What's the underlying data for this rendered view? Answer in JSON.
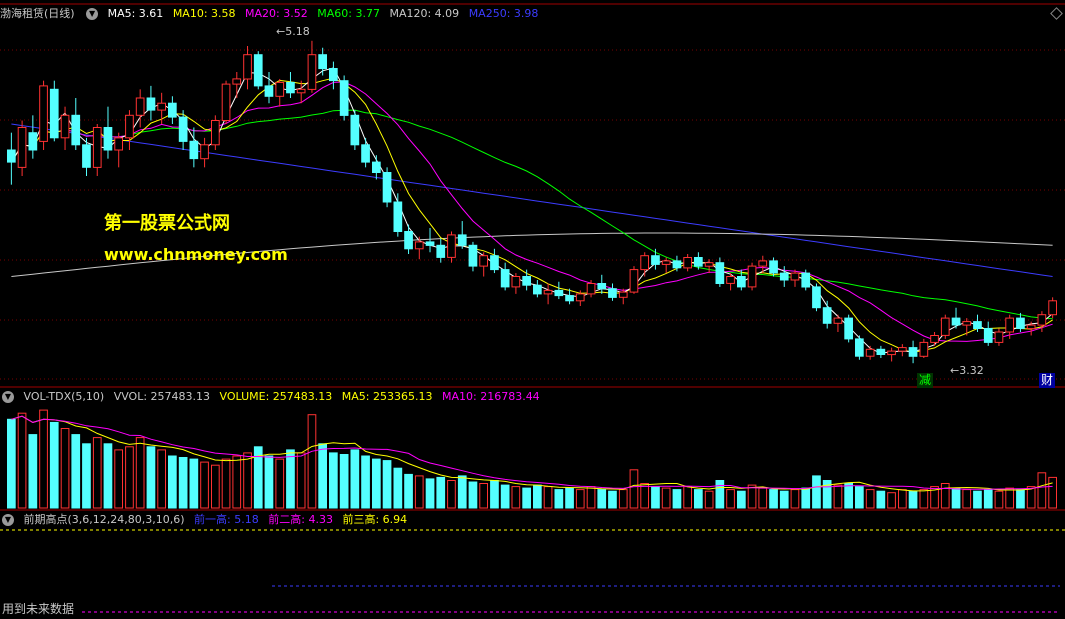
{
  "header": {
    "stock_name": "渤海租赁(日线)",
    "ma5": "MA5: 3.61",
    "ma10": "MA10: 3.58",
    "ma20": "MA20: 3.52",
    "ma60": "MA60: 3.77",
    "ma120": "MA120: 4.09",
    "ma250": "MA250: 3.98"
  },
  "vol_header": {
    "name": "VOL-TDX(5,10)",
    "vvol": "VVOL: 257483.13",
    "volume": "VOLUME: 257483.13",
    "ma5": "MA5: 253365.13",
    "ma10": "MA10: 216783.44"
  },
  "ind_header": {
    "name": "前期高点(3,6,12,24,80,3,10,6)",
    "h1": "前一高: 5.18",
    "h2": "前二高: 4.33",
    "h3": "前三高: 6.94"
  },
  "watermark": {
    "line1": "第一股票公式网",
    "line2": "www.chnmoney.com"
  },
  "annotations": {
    "high": "5.18",
    "low": "3.32",
    "tag_jian": "减",
    "tag_cai": "财"
  },
  "footer": "用到未来数据",
  "colors": {
    "up": "#ff3232",
    "down": "#54ffff",
    "ma5": "#ffffff",
    "ma10": "#ffff00",
    "ma20": "#ff00ff",
    "ma60": "#00ff00",
    "ma120": "#c8c8c8",
    "ma250": "#3c3cff",
    "grid": "#7a0000"
  },
  "chart_data": [
    {
      "type": "candlestick",
      "ylim": [
        3.2,
        5.3
      ],
      "annotated_high": 5.18,
      "annotated_low": 3.32,
      "candles": [
        [
          4.55,
          4.65,
          4.35,
          4.48
        ],
        [
          4.45,
          4.72,
          4.4,
          4.68
        ],
        [
          4.65,
          4.75,
          4.5,
          4.55
        ],
        [
          4.6,
          4.95,
          4.55,
          4.92
        ],
        [
          4.9,
          4.95,
          4.6,
          4.62
        ],
        [
          4.62,
          4.8,
          4.55,
          4.75
        ],
        [
          4.75,
          4.85,
          4.55,
          4.58
        ],
        [
          4.58,
          4.62,
          4.4,
          4.45
        ],
        [
          4.45,
          4.7,
          4.4,
          4.68
        ],
        [
          4.68,
          4.8,
          4.5,
          4.55
        ],
        [
          4.55,
          4.65,
          4.45,
          4.62
        ],
        [
          4.62,
          4.78,
          4.55,
          4.75
        ],
        [
          4.75,
          4.9,
          4.68,
          4.85
        ],
        [
          4.85,
          4.92,
          4.72,
          4.78
        ],
        [
          4.78,
          4.88,
          4.7,
          4.82
        ],
        [
          4.82,
          4.86,
          4.7,
          4.74
        ],
        [
          4.74,
          4.78,
          4.55,
          4.6
        ],
        [
          4.6,
          4.68,
          4.45,
          4.5
        ],
        [
          4.5,
          4.62,
          4.45,
          4.58
        ],
        [
          4.58,
          4.75,
          4.55,
          4.72
        ],
        [
          4.72,
          4.95,
          4.7,
          4.93
        ],
        [
          4.93,
          5.0,
          4.85,
          4.96
        ],
        [
          4.96,
          5.15,
          4.9,
          5.1
        ],
        [
          5.1,
          5.12,
          4.9,
          4.92
        ],
        [
          4.92,
          5.0,
          4.82,
          4.86
        ],
        [
          4.86,
          4.96,
          4.8,
          4.94
        ],
        [
          4.94,
          5.0,
          4.85,
          4.88
        ],
        [
          4.88,
          4.95,
          4.82,
          4.9
        ],
        [
          4.9,
          5.18,
          4.88,
          5.1
        ],
        [
          5.1,
          5.14,
          4.98,
          5.02
        ],
        [
          5.02,
          5.06,
          4.9,
          4.95
        ],
        [
          4.95,
          4.98,
          4.72,
          4.75
        ],
        [
          4.75,
          4.78,
          4.55,
          4.58
        ],
        [
          4.58,
          4.62,
          4.45,
          4.48
        ],
        [
          4.48,
          4.52,
          4.38,
          4.42
        ],
        [
          4.42,
          4.45,
          4.22,
          4.25
        ],
        [
          4.25,
          4.3,
          4.05,
          4.08
        ],
        [
          4.08,
          4.12,
          3.95,
          3.98
        ],
        [
          3.98,
          4.05,
          3.92,
          4.02
        ],
        [
          4.02,
          4.1,
          3.96,
          4.0
        ],
        [
          4.0,
          4.04,
          3.9,
          3.93
        ],
        [
          3.93,
          4.08,
          3.9,
          4.06
        ],
        [
          4.06,
          4.14,
          3.98,
          4.0
        ],
        [
          4.0,
          4.02,
          3.85,
          3.88
        ],
        [
          3.88,
          3.96,
          3.82,
          3.94
        ],
        [
          3.94,
          3.98,
          3.84,
          3.86
        ],
        [
          3.86,
          3.9,
          3.74,
          3.76
        ],
        [
          3.76,
          3.84,
          3.72,
          3.82
        ],
        [
          3.82,
          3.86,
          3.74,
          3.77
        ],
        [
          3.77,
          3.8,
          3.7,
          3.72
        ],
        [
          3.72,
          3.78,
          3.66,
          3.74
        ],
        [
          3.74,
          3.79,
          3.69,
          3.71
        ],
        [
          3.71,
          3.75,
          3.66,
          3.68
        ],
        [
          3.68,
          3.74,
          3.65,
          3.72
        ],
        [
          3.72,
          3.8,
          3.7,
          3.78
        ],
        [
          3.78,
          3.83,
          3.72,
          3.75
        ],
        [
          3.75,
          3.78,
          3.68,
          3.7
        ],
        [
          3.7,
          3.75,
          3.66,
          3.73
        ],
        [
          3.73,
          3.88,
          3.72,
          3.86
        ],
        [
          3.86,
          3.96,
          3.82,
          3.94
        ],
        [
          3.94,
          3.98,
          3.86,
          3.89
        ],
        [
          3.89,
          3.93,
          3.84,
          3.91
        ],
        [
          3.91,
          3.94,
          3.85,
          3.87
        ],
        [
          3.87,
          3.95,
          3.85,
          3.93
        ],
        [
          3.93,
          3.96,
          3.86,
          3.88
        ],
        [
          3.88,
          3.92,
          3.84,
          3.9
        ],
        [
          3.9,
          3.93,
          3.76,
          3.78
        ],
        [
          3.78,
          3.84,
          3.74,
          3.82
        ],
        [
          3.82,
          3.86,
          3.74,
          3.76
        ],
        [
          3.76,
          3.9,
          3.74,
          3.88
        ],
        [
          3.88,
          3.94,
          3.84,
          3.91
        ],
        [
          3.91,
          3.93,
          3.82,
          3.84
        ],
        [
          3.84,
          3.88,
          3.76,
          3.8
        ],
        [
          3.8,
          3.86,
          3.76,
          3.84
        ],
        [
          3.84,
          3.86,
          3.74,
          3.76
        ],
        [
          3.76,
          3.78,
          3.62,
          3.64
        ],
        [
          3.64,
          3.68,
          3.52,
          3.55
        ],
        [
          3.55,
          3.6,
          3.5,
          3.58
        ],
        [
          3.58,
          3.6,
          3.44,
          3.46
        ],
        [
          3.46,
          3.48,
          3.34,
          3.36
        ],
        [
          3.36,
          3.42,
          3.34,
          3.4
        ],
        [
          3.4,
          3.42,
          3.35,
          3.37
        ],
        [
          3.37,
          3.41,
          3.33,
          3.39
        ],
        [
          3.39,
          3.43,
          3.36,
          3.41
        ],
        [
          3.41,
          3.45,
          3.32,
          3.36
        ],
        [
          3.36,
          3.46,
          3.35,
          3.44
        ],
        [
          3.44,
          3.5,
          3.42,
          3.48
        ],
        [
          3.48,
          3.6,
          3.46,
          3.58
        ],
        [
          3.58,
          3.64,
          3.52,
          3.54
        ],
        [
          3.54,
          3.58,
          3.48,
          3.56
        ],
        [
          3.56,
          3.6,
          3.5,
          3.52
        ],
        [
          3.52,
          3.56,
          3.42,
          3.44
        ],
        [
          3.44,
          3.52,
          3.42,
          3.5
        ],
        [
          3.5,
          3.6,
          3.46,
          3.58
        ],
        [
          3.58,
          3.61,
          3.5,
          3.52
        ],
        [
          3.52,
          3.56,
          3.48,
          3.54
        ],
        [
          3.54,
          3.62,
          3.5,
          3.6
        ],
        [
          3.6,
          3.7,
          3.58,
          3.68
        ]
      ],
      "ma250_range": [
        4.7,
        3.82
      ],
      "ma120_range": [
        3.82,
        4.0
      ]
    },
    {
      "type": "bar",
      "title": "VOL-TDX(5,10)",
      "volumes": [
        580000,
        620000,
        480000,
        640000,
        560000,
        520000,
        480000,
        420000,
        460000,
        420000,
        380000,
        400000,
        460000,
        400000,
        380000,
        340000,
        330000,
        320000,
        300000,
        280000,
        320000,
        340000,
        360000,
        400000,
        340000,
        320000,
        380000,
        360000,
        610000,
        420000,
        360000,
        350000,
        380000,
        340000,
        320000,
        310000,
        260000,
        220000,
        210000,
        190000,
        200000,
        180000,
        210000,
        170000,
        160000,
        180000,
        150000,
        140000,
        130000,
        150000,
        140000,
        120000,
        130000,
        120000,
        140000,
        120000,
        110000,
        120000,
        250000,
        160000,
        140000,
        130000,
        120000,
        140000,
        120000,
        110000,
        180000,
        120000,
        110000,
        150000,
        130000,
        120000,
        110000,
        120000,
        130000,
        210000,
        180000,
        150000,
        160000,
        140000,
        120000,
        110000,
        100000,
        120000,
        110000,
        120000,
        140000,
        160000,
        130000,
        120000,
        110000,
        120000,
        110000,
        130000,
        120000,
        140000,
        230000,
        200000
      ]
    }
  ]
}
